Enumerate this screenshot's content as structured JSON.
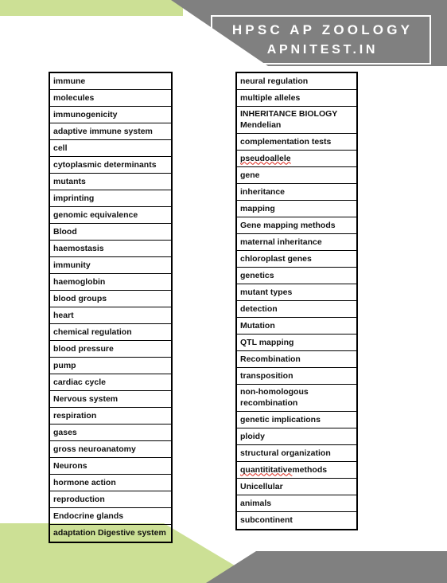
{
  "header": {
    "title_line1": "HPSC AP ZOOLOGY",
    "title_line2": "APNITEST.IN"
  },
  "colors": {
    "accent_green": "#cce095",
    "band_gray": "#808080",
    "border_black": "#000000",
    "spellcheck_red": "#e03b2f",
    "text": "#111111",
    "page_background": "#ffffff"
  },
  "columns": {
    "left": {
      "items": [
        {
          "text": "immune",
          "misspelled": false,
          "lines": 1
        },
        {
          "text": "molecules",
          "misspelled": false,
          "lines": 1
        },
        {
          "text": "immunogenicity",
          "misspelled": false,
          "lines": 1
        },
        {
          "text": "adaptive immune system",
          "misspelled": false,
          "lines": 1
        },
        {
          "text": "cell",
          "misspelled": false,
          "lines": 1
        },
        {
          "text": "cytoplasmic determinants",
          "misspelled": false,
          "lines": 1
        },
        {
          "text": "mutants",
          "misspelled": false,
          "lines": 1
        },
        {
          "text": "imprinting",
          "misspelled": false,
          "lines": 1
        },
        {
          "text": "genomic equivalence",
          "misspelled": false,
          "lines": 1
        },
        {
          "text": "Blood",
          "misspelled": false,
          "lines": 1
        },
        {
          "text": "haemostasis",
          "misspelled": false,
          "lines": 1
        },
        {
          "text": "immunity",
          "misspelled": false,
          "lines": 1
        },
        {
          "text": "haemoglobin",
          "misspelled": false,
          "lines": 1
        },
        {
          "text": "blood groups",
          "misspelled": false,
          "lines": 1
        },
        {
          "text": "heart",
          "misspelled": false,
          "lines": 1
        },
        {
          "text": "chemical regulation",
          "misspelled": false,
          "lines": 1
        },
        {
          "text": "blood pressure",
          "misspelled": false,
          "lines": 1
        },
        {
          "text": "pump",
          "misspelled": false,
          "lines": 1
        },
        {
          "text": "cardiac cycle",
          "misspelled": false,
          "lines": 1
        },
        {
          "text": "Nervous system",
          "misspelled": false,
          "lines": 1
        },
        {
          "text": "respiration",
          "misspelled": false,
          "lines": 1
        },
        {
          "text": "gases",
          "misspelled": false,
          "lines": 1
        },
        {
          "text": "gross neuroanatomy",
          "misspelled": false,
          "lines": 1
        },
        {
          "text": "Neurons",
          "misspelled": false,
          "lines": 1
        },
        {
          "text": "hormone action",
          "misspelled": false,
          "lines": 1
        },
        {
          "text": "reproduction",
          "misspelled": false,
          "lines": 1
        },
        {
          "text": "Endocrine glands",
          "misspelled": false,
          "lines": 1
        },
        {
          "text": "adaptation Digestive system",
          "misspelled": false,
          "lines": 1
        }
      ]
    },
    "right": {
      "items": [
        {
          "text": "neural regulation",
          "misspelled": false,
          "lines": 1
        },
        {
          "text": "multiple alleles",
          "misspelled": false,
          "lines": 1
        },
        {
          "text": "INHERITANCE BIOLOGY\nMendelian",
          "misspelled": false,
          "lines": 2
        },
        {
          "text": "complementation tests",
          "misspelled": false,
          "lines": 1
        },
        {
          "text": "pseudoallele",
          "misspelled": true,
          "lines": 1
        },
        {
          "text": "gene",
          "misspelled": false,
          "lines": 1
        },
        {
          "text": "inheritance",
          "misspelled": false,
          "lines": 1
        },
        {
          "text": "mapping",
          "misspelled": false,
          "lines": 1
        },
        {
          "text": "Gene mapping methods",
          "misspelled": false,
          "lines": 1
        },
        {
          "text": "maternal inheritance",
          "misspelled": false,
          "lines": 1
        },
        {
          "text": "chloroplast genes",
          "misspelled": false,
          "lines": 1
        },
        {
          "text": "genetics",
          "misspelled": false,
          "lines": 1
        },
        {
          "text": "mutant types",
          "misspelled": false,
          "lines": 1
        },
        {
          "text": "detection",
          "misspelled": false,
          "lines": 1
        },
        {
          "text": "Mutation",
          "misspelled": false,
          "lines": 1
        },
        {
          "text": "QTL mapping",
          "misspelled": false,
          "lines": 1
        },
        {
          "text": "Recombination",
          "misspelled": false,
          "lines": 1
        },
        {
          "text": "transposition",
          "misspelled": false,
          "lines": 1
        },
        {
          "text": "non-homologous\nrecombination",
          "misspelled": false,
          "lines": 2
        },
        {
          "text": "genetic implications",
          "misspelled": false,
          "lines": 1
        },
        {
          "text": "ploidy",
          "misspelled": false,
          "lines": 1
        },
        {
          "text": "structural organization",
          "misspelled": false,
          "lines": 1
        },
        {
          "text": "quantititative methods",
          "misspelled": true,
          "lines": 1
        },
        {
          "text": "Unicellular",
          "misspelled": false,
          "lines": 1
        },
        {
          "text": "animals",
          "misspelled": false,
          "lines": 1
        },
        {
          "text": "subcontinent",
          "misspelled": false,
          "lines": 1
        }
      ]
    }
  }
}
